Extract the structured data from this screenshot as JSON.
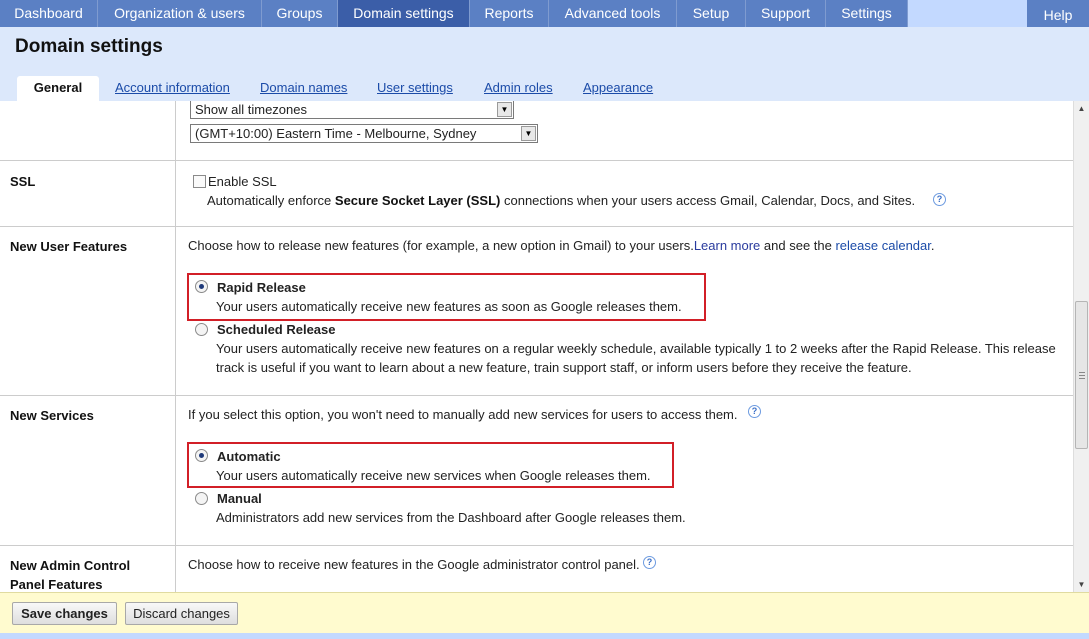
{
  "nav": {
    "items": [
      "Dashboard",
      "Organization & users",
      "Groups",
      "Domain settings",
      "Reports",
      "Advanced tools",
      "Setup",
      "Support",
      "Settings"
    ],
    "active": "Domain settings",
    "help": "Help"
  },
  "page": {
    "title": "Domain settings"
  },
  "tabs": [
    "General",
    "Account information",
    "Domain names",
    "User settings",
    "Admin roles",
    "Appearance"
  ],
  "timezone": {
    "filter_value": "Show all timezones",
    "zone_value": "(GMT+10:00) Eastern Time - Melbourne, Sydney"
  },
  "ssl": {
    "label": "SSL",
    "checkbox_label": "Enable SSL",
    "desc_before": "Automatically enforce ",
    "desc_bold": "Secure Socket Layer (SSL)",
    "desc_after": " connections when your users access Gmail, Calendar, Docs, and Sites."
  },
  "new_user_features": {
    "label": "New User Features",
    "intro": "Choose how to release new features (for example, a new option in Gmail) to your users.",
    "learn_more": "Learn more",
    "and_see": " and see the ",
    "release_calendar": "release calendar",
    "period": ".",
    "options": [
      {
        "title": "Rapid Release",
        "desc": "Your users automatically receive new features as soon as Google releases them.",
        "checked": true
      },
      {
        "title": "Scheduled Release",
        "desc_line1": "Your users automatically receive new features on a regular weekly schedule, available typically 1 to 2 weeks after the Rapid Release. This release",
        "desc_line2": "track is useful if you want to learn about a new feature, train support staff, or inform users before they receive the feature.",
        "checked": false
      }
    ]
  },
  "new_services": {
    "label": "New Services",
    "intro": "If you select this option, you won't need to manually add new services for users to access them.",
    "options": [
      {
        "title": "Automatic",
        "desc": "Your users automatically receive new services when Google releases them.",
        "checked": true
      },
      {
        "title": "Manual",
        "desc": "Administrators add new services from the Dashboard after Google releases them.",
        "checked": false
      }
    ]
  },
  "new_admin": {
    "label_line1": "New Admin Control",
    "label_line2": "Panel Features",
    "intro": "Choose how to receive new features in the Google administrator control panel."
  },
  "footer": {
    "save": "Save changes",
    "discard": "Discard changes"
  },
  "colors": {
    "nav_bg": "#5b80c4",
    "nav_active": "#3b5ea8",
    "highlight_box": "#d21f27",
    "footer_bg": "#fffbcf"
  }
}
